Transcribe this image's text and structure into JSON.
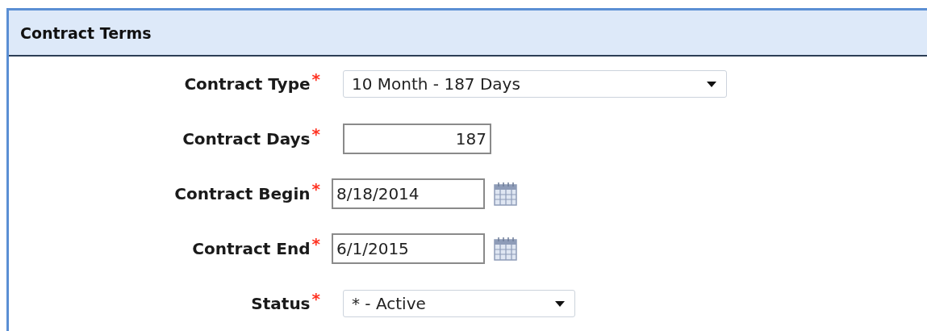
{
  "panel": {
    "title": "Contract Terms"
  },
  "fields": [
    {
      "label": "Contract Type",
      "required_mark": "*",
      "kind": "select",
      "value": "10 Month - 187 Days"
    },
    {
      "label": "Contract Days",
      "required_mark": "*",
      "kind": "number",
      "value": "187"
    },
    {
      "label": "Contract Begin",
      "required_mark": "*",
      "kind": "date",
      "value": "8/18/2014"
    },
    {
      "label": "Contract End",
      "required_mark": "*",
      "kind": "date",
      "value": "6/1/2015"
    },
    {
      "label": "Status",
      "required_mark": "*",
      "kind": "select",
      "value": "* - Active"
    }
  ]
}
